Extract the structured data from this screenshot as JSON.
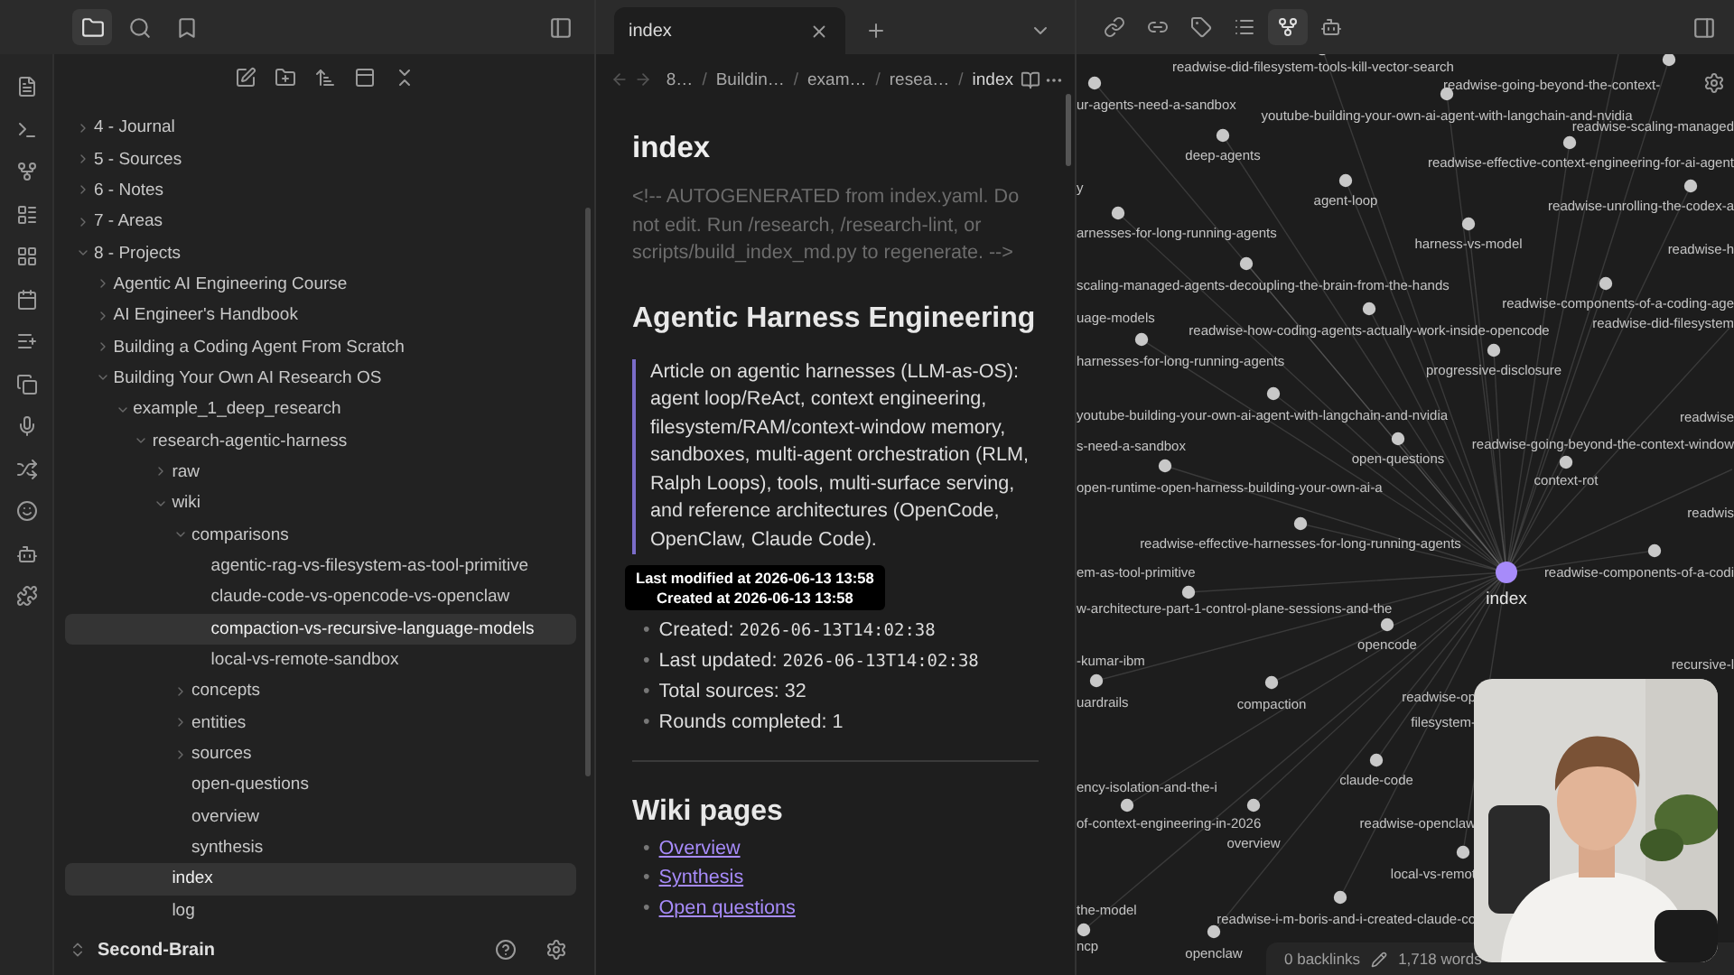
{
  "left_header": {
    "tabs": [
      {
        "selected": true
      },
      {
        "selected": false
      },
      {
        "selected": false
      }
    ]
  },
  "sidebar": {
    "tree": [
      {
        "label": "4 - Journal",
        "kind": "folder",
        "expanded": false,
        "selected": false
      },
      {
        "label": "5 - Sources",
        "kind": "folder",
        "expanded": false,
        "selected": false
      },
      {
        "label": "6 - Notes",
        "kind": "folder",
        "expanded": false,
        "selected": false
      },
      {
        "label": "7 - Areas",
        "kind": "folder",
        "expanded": false,
        "selected": false
      },
      {
        "label": "8 - Projects",
        "kind": "folder",
        "expanded": true,
        "selected": false,
        "children": [
          {
            "label": "Agentic AI Engineering Course",
            "kind": "folder",
            "expanded": false,
            "selected": false
          },
          {
            "label": "AI Engineer's Handbook",
            "kind": "folder",
            "expanded": false,
            "selected": false
          },
          {
            "label": "Building a Coding Agent From Scratch",
            "kind": "folder",
            "expanded": false,
            "selected": false
          },
          {
            "label": "Building Your Own AI Research OS",
            "kind": "folder",
            "expanded": true,
            "selected": false,
            "children": [
              {
                "label": "example_1_deep_research",
                "kind": "folder",
                "expanded": true,
                "selected": false,
                "children": [
                  {
                    "label": "research-agentic-harness",
                    "kind": "folder",
                    "expanded": true,
                    "selected": false,
                    "children": [
                      {
                        "label": "raw",
                        "kind": "folder",
                        "expanded": false,
                        "selected": false
                      },
                      {
                        "label": "wiki",
                        "kind": "folder",
                        "expanded": true,
                        "selected": false,
                        "children": [
                          {
                            "label": "comparisons",
                            "kind": "folder",
                            "expanded": true,
                            "selected": false,
                            "children": [
                              {
                                "label": "agentic-rag-vs-filesystem-as-tool-primitive",
                                "kind": "file",
                                "selected": false
                              },
                              {
                                "label": "claude-code-vs-opencode-vs-openclaw",
                                "kind": "file",
                                "selected": false
                              },
                              {
                                "label": "compaction-vs-recursive-language-models",
                                "kind": "file",
                                "selected": true
                              },
                              {
                                "label": "local-vs-remote-sandbox",
                                "kind": "file",
                                "selected": false
                              }
                            ]
                          },
                          {
                            "label": "concepts",
                            "kind": "folder",
                            "expanded": false,
                            "selected": false
                          },
                          {
                            "label": "entities",
                            "kind": "folder",
                            "expanded": false,
                            "selected": false
                          },
                          {
                            "label": "sources",
                            "kind": "folder",
                            "expanded": false,
                            "selected": false
                          },
                          {
                            "label": "open-questions",
                            "kind": "file",
                            "selected": false
                          },
                          {
                            "label": "overview",
                            "kind": "file",
                            "selected": false
                          },
                          {
                            "label": "synthesis",
                            "kind": "file",
                            "selected": false
                          }
                        ]
                      },
                      {
                        "label": "index",
                        "kind": "file",
                        "selected": true
                      },
                      {
                        "label": "log",
                        "kind": "file",
                        "selected": false
                      }
                    ]
                  }
                ]
              }
            ]
          }
        ]
      }
    ],
    "vault": "Second-Brain"
  },
  "tab": {
    "title": "index"
  },
  "breadcrumbs": [
    {
      "label": "8…"
    },
    {
      "separator": "/",
      "label": "Buildin…"
    },
    {
      "separator": "/",
      "label": "exam…"
    },
    {
      "separator": "/",
      "label": "resea…"
    },
    {
      "separator": "/",
      "label": "index"
    }
  ],
  "note": {
    "title": "index",
    "comment": "<!-- AUTOGENERATED from index.yaml. Do not edit. Run /research, /research-lint, or scripts/build_index_md.py to regenerate. -->",
    "heading": "Agentic Harness Engineering",
    "quote": "Article on agentic harnesses (LLM-as-OS): agent loop/ReAct, context engineering, filesystem/RAM/context-window memory, sandboxes, multi-agent orchestration (RLM, Ralph Loops), tools, multi-surface serving, and reference architectures (OpenCode, OpenClaw, Claude Code).",
    "tooltip": [
      "Last modified at 2026-06-13 13:58",
      "Created at 2026-06-13 13:58"
    ],
    "facts": [
      {
        "marker": "•",
        "label": "Created:",
        "value": "2026-06-13T14:02:38"
      },
      {
        "marker": "•",
        "label": "Last updated:",
        "value": "2026-06-13T14:02:38"
      },
      {
        "marker": "•",
        "label": "Total sources: 32"
      },
      {
        "marker": "•",
        "label": "Rounds completed: 1"
      }
    ],
    "section": "Wiki pages",
    "links": [
      {
        "marker": "•",
        "label": "Overview"
      },
      {
        "marker": "•",
        "label": "Synthesis"
      },
      {
        "marker": "•",
        "label": "Open questions"
      }
    ]
  },
  "graph_header": {
    "tabs": [
      {
        "selected": false
      },
      {
        "selected": false
      },
      {
        "selected": false
      },
      {
        "selected": false
      },
      {
        "selected": true
      },
      {
        "selected": false
      }
    ]
  },
  "graph": {
    "nodes": [
      {
        "label": "readwise-did-filesystem-tools-kill-vector-search",
        "selected": false
      },
      {
        "label": "readwise-going-beyond-the-context-",
        "selected": false
      },
      {
        "label": "ur-agents-need-a-sandbox",
        "selected": false
      },
      {
        "label": "youtube-building-your-own-ai-agent-with-langchain-and-nvidia",
        "selected": false
      },
      {
        "label": "readwise-scaling-managed",
        "selected": false
      },
      {
        "label": "readwise-effective-context-engineering-for-ai-agent",
        "selected": false
      },
      {
        "label": "deep-agents",
        "selected": false
      },
      {
        "label": "y",
        "selected": false
      },
      {
        "label": "agent-loop",
        "selected": false
      },
      {
        "label": "readwise-unrolling-the-codex-a",
        "selected": false
      },
      {
        "label": "arnesses-for-long-running-agents",
        "selected": false
      },
      {
        "label": "harness-vs-model",
        "selected": false
      },
      {
        "label": "readwise-h",
        "selected": false
      },
      {
        "label": "scaling-managed-agents-decoupling-the-brain-from-the-hands",
        "selected": false
      },
      {
        "label": "readwise-components-of-a-coding-age",
        "selected": false
      },
      {
        "label": "uage-models",
        "selected": false
      },
      {
        "label": "readwise-how-coding-agents-actually-work-inside-opencode",
        "selected": false
      },
      {
        "label": "readwise-did-filesystem",
        "selected": false
      },
      {
        "label": "harnesses-for-long-running-agents",
        "selected": false
      },
      {
        "label": "progressive-disclosure",
        "selected": false
      },
      {
        "label": "youtube-building-your-own-ai-agent-with-langchain-and-nvidia",
        "selected": false
      },
      {
        "label": "readwise",
        "selected": false
      },
      {
        "label": "open-questions",
        "selected": false
      },
      {
        "label": "s-need-a-sandbox",
        "selected": false
      },
      {
        "label": "readwise-going-beyond-the-context-window",
        "selected": false
      },
      {
        "label": "context-rot",
        "selected": false
      },
      {
        "label": "open-runtime-open-harness-building-your-own-ai-a",
        "selected": false
      },
      {
        "label": "readwis",
        "selected": false
      },
      {
        "label": "readwise-effective-harnesses-for-long-running-agents",
        "selected": false
      },
      {
        "label": "em-as-tool-primitive",
        "selected": false
      },
      {
        "label": "readwise-components-of-a-codi",
        "selected": false
      },
      {
        "label": "index",
        "selected": true
      },
      {
        "label": "w-architecture-part-1-control-plane-sessions-and-the",
        "selected": false
      },
      {
        "label": "opencode",
        "selected": false
      },
      {
        "label": "recursive-l",
        "selected": false
      },
      {
        "label": "-kumar-ibm",
        "selected": false
      },
      {
        "label": "uardrails",
        "selected": false
      },
      {
        "label": "compaction",
        "selected": false
      },
      {
        "label": "readwise-op",
        "selected": false
      },
      {
        "label": "filesystem-",
        "selected": false
      },
      {
        "label": "claude-code",
        "selected": false
      },
      {
        "label": "ency-isolation-and-the-i",
        "selected": false
      },
      {
        "label": "of-context-engineering-in-2026",
        "selected": false
      },
      {
        "label": "overview",
        "selected": false
      },
      {
        "label": "readwise-openclaw",
        "selected": false
      },
      {
        "label": "local-vs-remot",
        "selected": false
      },
      {
        "label": "the-model",
        "selected": false
      },
      {
        "label": "readwise-i-m-boris-and-i-created-claude-co",
        "selected": false
      },
      {
        "label": "openclaw",
        "selected": false
      },
      {
        "label": "ncp",
        "selected": false
      }
    ]
  },
  "status_bar": {
    "backlinks": "0 backlinks",
    "words": "1,718 words"
  }
}
